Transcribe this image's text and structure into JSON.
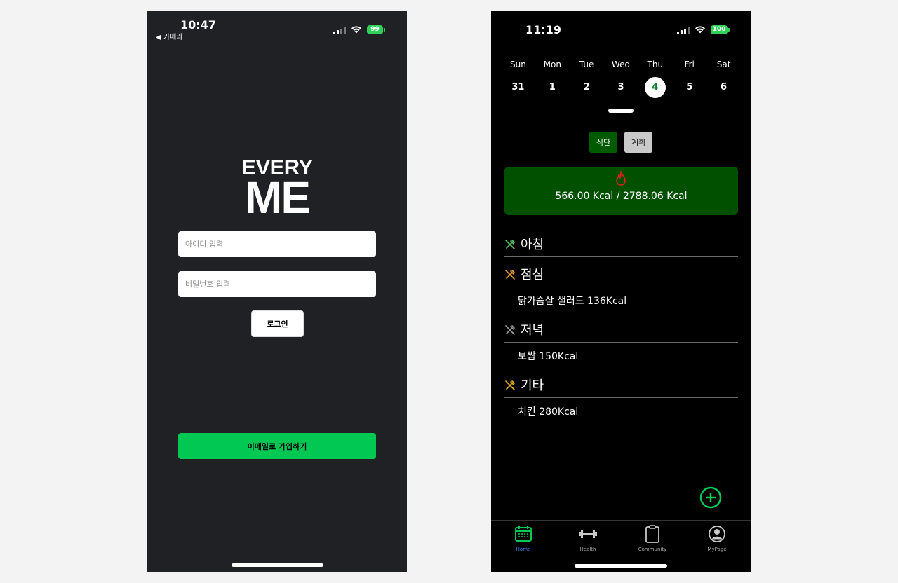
{
  "login_screen": {
    "status_bar": {
      "time": "10:47",
      "back_label": "◀ 카메라",
      "battery": "99"
    },
    "logo_line1": "EVERY",
    "logo_line2": "ME",
    "id_placeholder": "아이디 입력",
    "password_placeholder": "비밀번호 입력",
    "login_label": "로그인",
    "signup_label": "이메일로 가입하기"
  },
  "home_screen": {
    "status_bar": {
      "time": "11:19",
      "battery": "100"
    },
    "week": [
      {
        "name": "Sun",
        "date": "31"
      },
      {
        "name": "Mon",
        "date": "1"
      },
      {
        "name": "Tue",
        "date": "2"
      },
      {
        "name": "Wed",
        "date": "3"
      },
      {
        "name": "Thu",
        "date": "4"
      },
      {
        "name": "Fri",
        "date": "5"
      },
      {
        "name": "Sat",
        "date": "6"
      }
    ],
    "selected_day_index": 4,
    "tabs": {
      "diet": "식단",
      "plan": "계획"
    },
    "calories": "566.00 Kcal / 2788.06 Kcal",
    "meals": [
      {
        "title": "아침",
        "icon": "utensils-icon",
        "color": "#5cc86a",
        "items": []
      },
      {
        "title": "점심",
        "icon": "utensils-icon",
        "color": "#f0a030",
        "items": [
          "닭가슴살 샐러드 136Kcal"
        ]
      },
      {
        "title": "저녁",
        "icon": "utensils-icon",
        "color": "#9a9a9a",
        "items": [
          "보쌈 150Kcal"
        ]
      },
      {
        "title": "기타",
        "icon": "utensils-icon",
        "color": "#e0b020",
        "items": [
          "치킨 280Kcal"
        ]
      }
    ],
    "tab_bar": [
      {
        "label": "Home",
        "icon": "calendar-icon",
        "active": true
      },
      {
        "label": "Health",
        "icon": "dumbbell-icon",
        "active": false
      },
      {
        "label": "Community",
        "icon": "clipboard-icon",
        "active": false
      },
      {
        "label": "MyPage",
        "icon": "user-circle-icon",
        "active": false
      }
    ],
    "colors": {
      "accent_green": "#00c853",
      "card_green": "#005000",
      "flame_red": "#e02020"
    }
  }
}
